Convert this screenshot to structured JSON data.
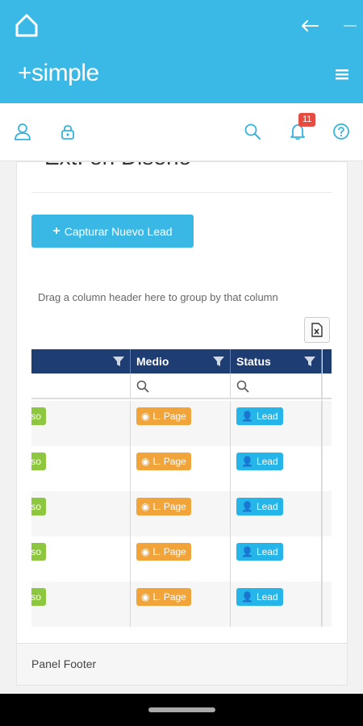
{
  "app": {
    "brand": "+simple"
  },
  "iconbar": {
    "notification_count": "11"
  },
  "panel": {
    "title": "Ext. en Diseño",
    "capture_button": "Capturar Nuevo Lead",
    "group_hint": "Drag a column header here to group by that column",
    "footer": "Panel Footer"
  },
  "grid": {
    "columns": [
      {
        "label": ""
      },
      {
        "label": "Medio"
      },
      {
        "label": "Status"
      }
    ],
    "rows": [
      {
        "source_tail": "so",
        "medio": "L. Page",
        "status": "Lead"
      },
      {
        "source_tail": "so",
        "medio": "L. Page",
        "status": "Lead"
      },
      {
        "source_tail": "so",
        "medio": "L. Page",
        "status": "Lead"
      },
      {
        "source_tail": "so",
        "medio": "L. Page",
        "status": "Lead"
      },
      {
        "source_tail": "so",
        "medio": "L. Page",
        "status": "Lead"
      }
    ]
  },
  "colors": {
    "primary": "#3bb9e6",
    "grid_header": "#1e3d72",
    "lpage": "#f0a43a",
    "lead": "#25b5e8",
    "green": "#8dc63f",
    "badge": "#e54d42"
  },
  "icons": {
    "home": "home-icon",
    "back": "arrow-left-icon",
    "menu": "hamburger-icon",
    "user": "user-icon",
    "lock": "lock-icon",
    "search": "search-icon",
    "bell": "bell-icon",
    "help": "help-icon",
    "filter": "funnel-icon",
    "export": "excel-export-icon"
  }
}
